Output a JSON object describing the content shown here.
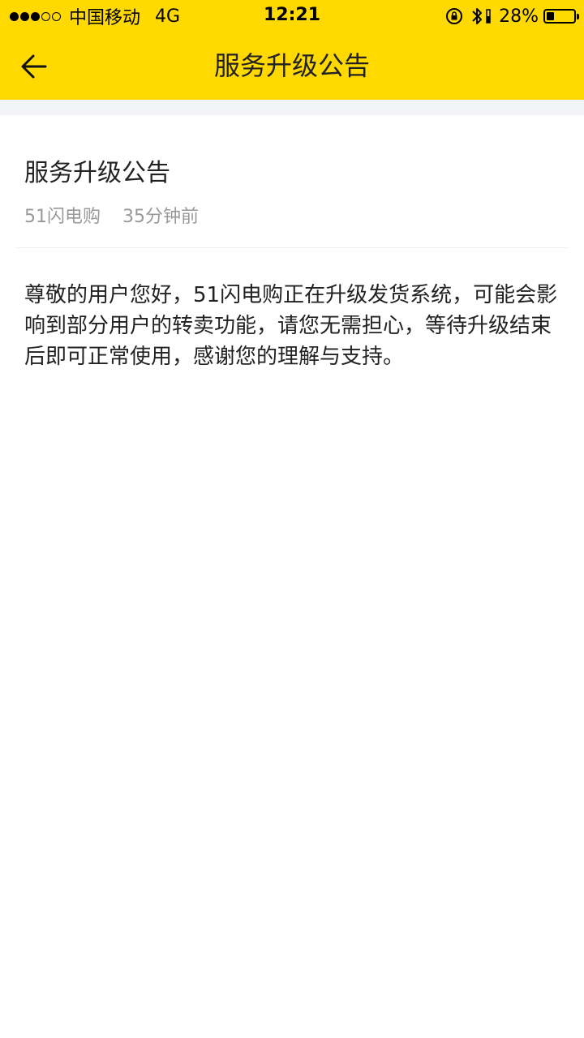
{
  "status_bar": {
    "carrier": "中国移动",
    "network": "4G",
    "time": "12:21",
    "battery_percent": "28%",
    "battery_level": 0.28,
    "signal_strength": 3,
    "icons": [
      "orientation-lock-icon",
      "bluetooth-icon",
      "battery-icon"
    ]
  },
  "nav": {
    "back_icon": "arrow-left-icon",
    "title": "服务升级公告"
  },
  "article": {
    "title": "服务升级公告",
    "source": "51闪电购",
    "time_ago": "35分钟前",
    "body": "尊敬的用户您好，51闪电购正在升级发货系统，可能会影响到部分用户的转卖功能，请您无需担心，等待升级结束后即可正常使用，感谢您的理解与支持。"
  },
  "colors": {
    "brand_yellow": "#ffd900",
    "separator_gray": "#f2f3f7",
    "meta_gray": "#999999"
  }
}
